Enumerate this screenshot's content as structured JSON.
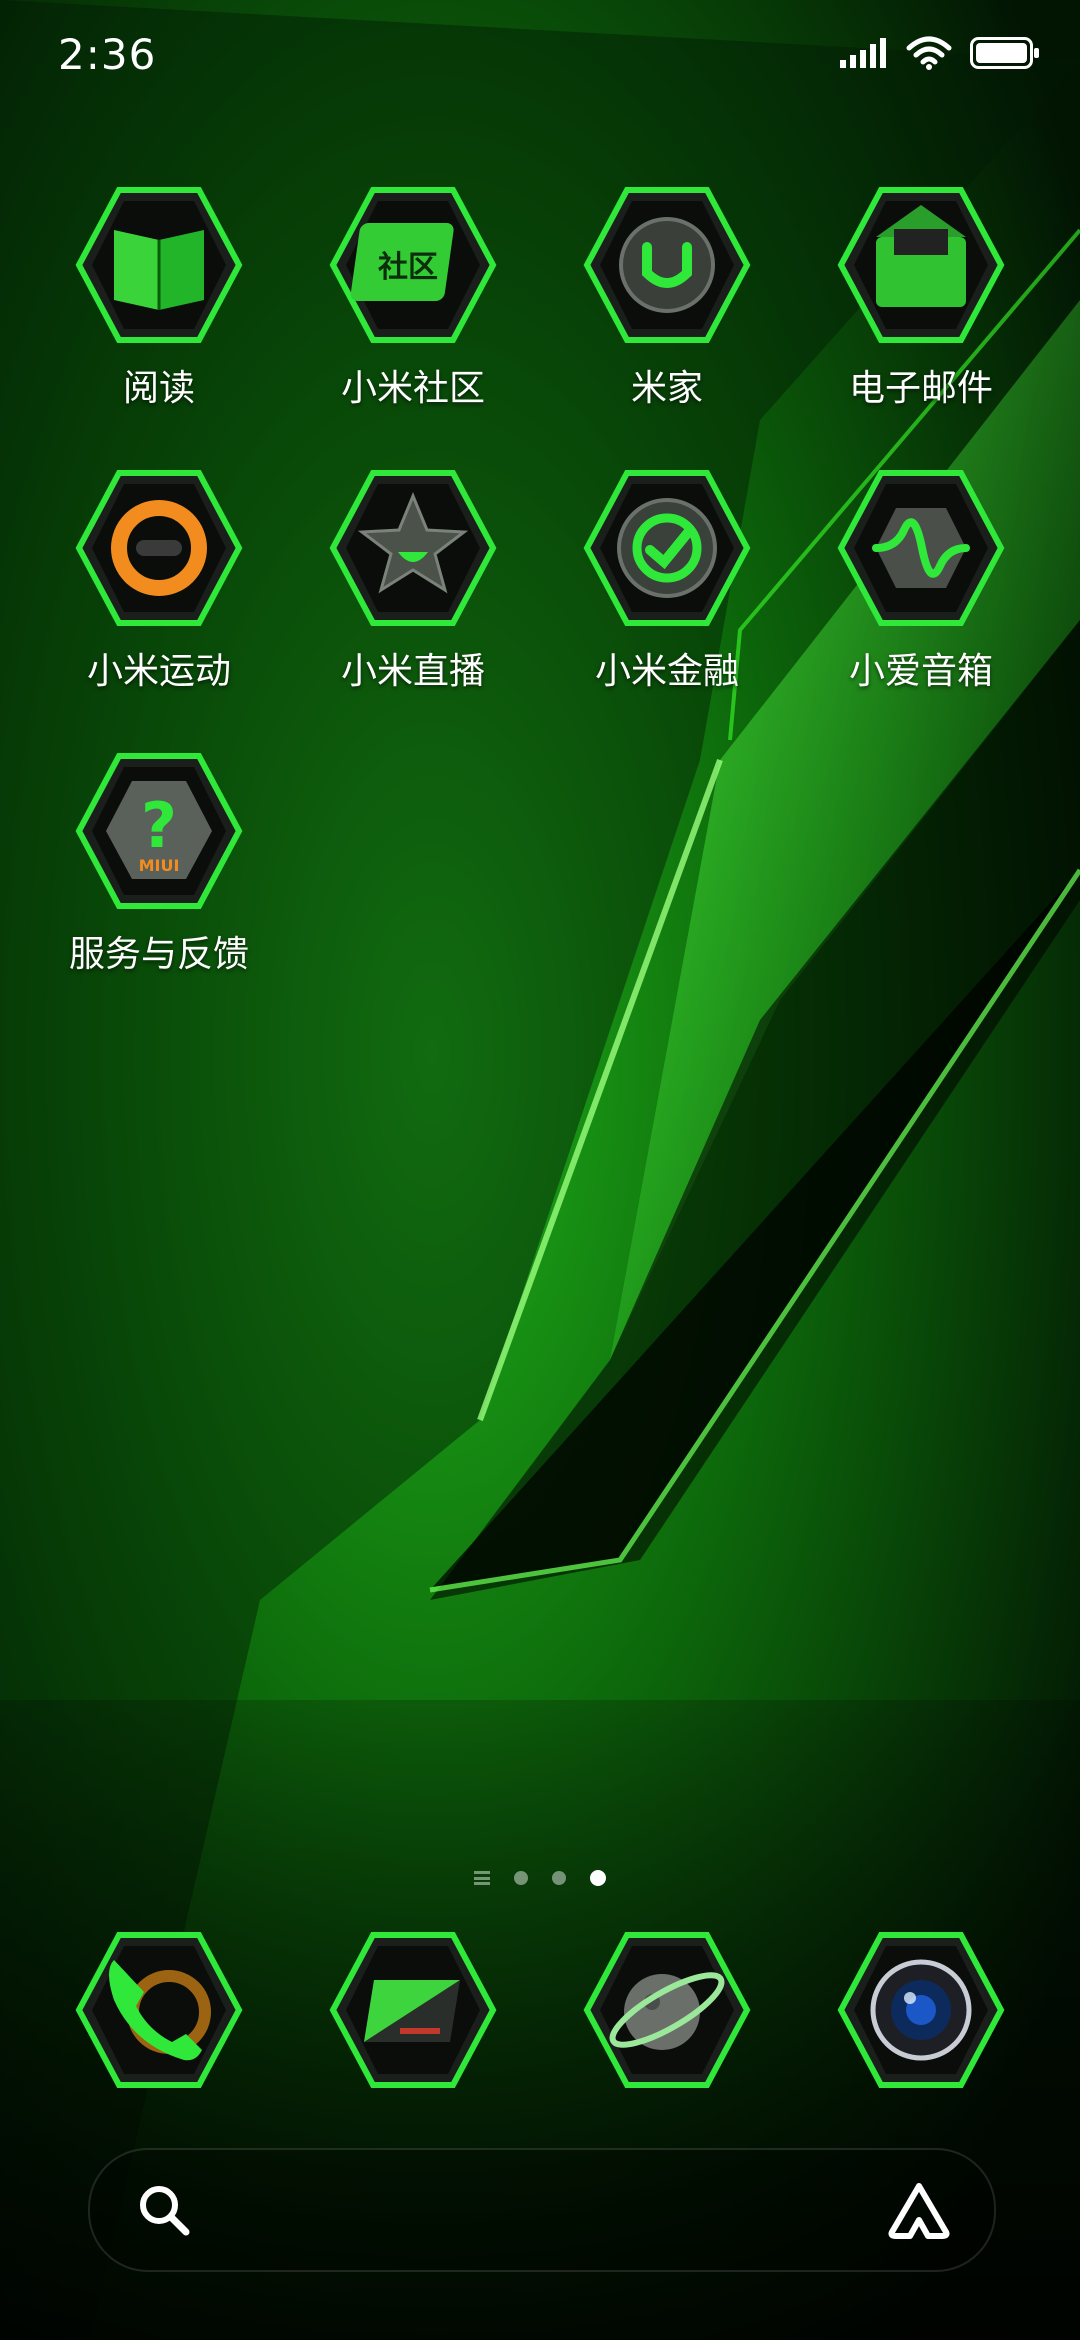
{
  "status_bar": {
    "time": "2:36"
  },
  "home": {
    "rows": [
      [
        {
          "label": "阅读",
          "icon": "book-icon"
        },
        {
          "label": "小米社区",
          "icon": "community-icon",
          "glyph": "社区"
        },
        {
          "label": "米家",
          "icon": "mijia-icon"
        },
        {
          "label": "电子邮件",
          "icon": "mail-icon"
        }
      ],
      [
        {
          "label": "小米运动",
          "icon": "fitness-ring-icon"
        },
        {
          "label": "小米直播",
          "icon": "star-icon"
        },
        {
          "label": "小米金融",
          "icon": "finance-check-icon"
        },
        {
          "label": "小爱音箱",
          "icon": "wave-icon"
        }
      ],
      [
        {
          "label": "服务与反馈",
          "icon": "help-icon",
          "glyph": "?",
          "brand": "MIUI"
        }
      ]
    ],
    "dock": [
      {
        "name": "phone",
        "icon": "phone-icon"
      },
      {
        "name": "messages",
        "icon": "message-icon"
      },
      {
        "name": "browser",
        "icon": "planet-icon"
      },
      {
        "name": "camera",
        "icon": "camera-lens-icon"
      }
    ],
    "page_indicator": {
      "pages": 3,
      "active": 3
    }
  },
  "colors": {
    "accent": "#2fe83a",
    "frame": "#1b1f1b"
  }
}
